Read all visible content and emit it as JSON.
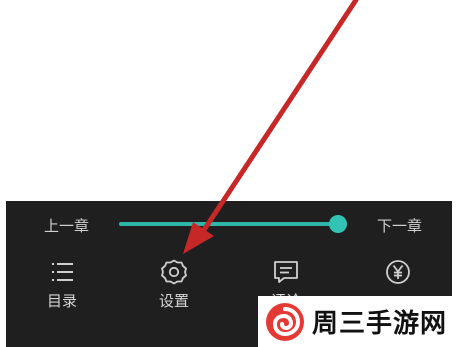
{
  "reader": {
    "prev_chapter": "上一章",
    "next_chapter": "下一章",
    "progress": 0.98,
    "accent_color": "#2fb7aa",
    "menu": [
      {
        "label": "目录",
        "icon": "list-icon"
      },
      {
        "label": "设置",
        "icon": "gear-icon"
      },
      {
        "label": "评论",
        "icon": "comment-icon"
      },
      {
        "label": "",
        "icon": "yen-icon"
      }
    ]
  },
  "annotation": {
    "arrow_color": "#c62828",
    "icon": "arrow-icon"
  },
  "watermark": {
    "text": "周三手游网",
    "logo_color": "#e53935",
    "icon": "swirl-logo-icon"
  }
}
